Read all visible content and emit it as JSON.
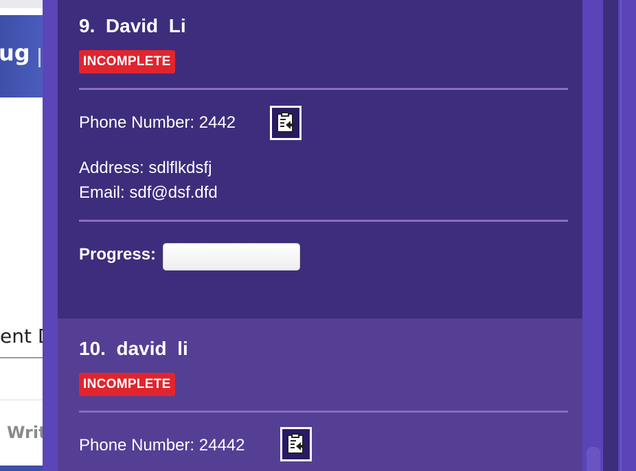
{
  "background": {
    "header_fragment": "ug",
    "section_fragment": "ent D",
    "tab_fragment": "Writ"
  },
  "contacts": [
    {
      "title": "9.  David  Li",
      "status": "INCOMPLETE",
      "phone_label": "Phone Number: 2442",
      "address": "Address: sdlflkdsfj",
      "email": "Email: sdf@dsf.dfd",
      "progress_label": "Progress:",
      "progress_value": 0
    },
    {
      "title": "10.  david  li",
      "status": "INCOMPLETE",
      "phone_label": "Phone Number: 24442"
    }
  ],
  "colors": {
    "card_bg": "#3e2d7c",
    "card_bg_alt": "#543f95",
    "status_badge": "#e0252e",
    "divider": "#8a6cc9",
    "panel": "#5a44b8"
  },
  "icons": {
    "copy": "clipboard-copy-icon"
  }
}
